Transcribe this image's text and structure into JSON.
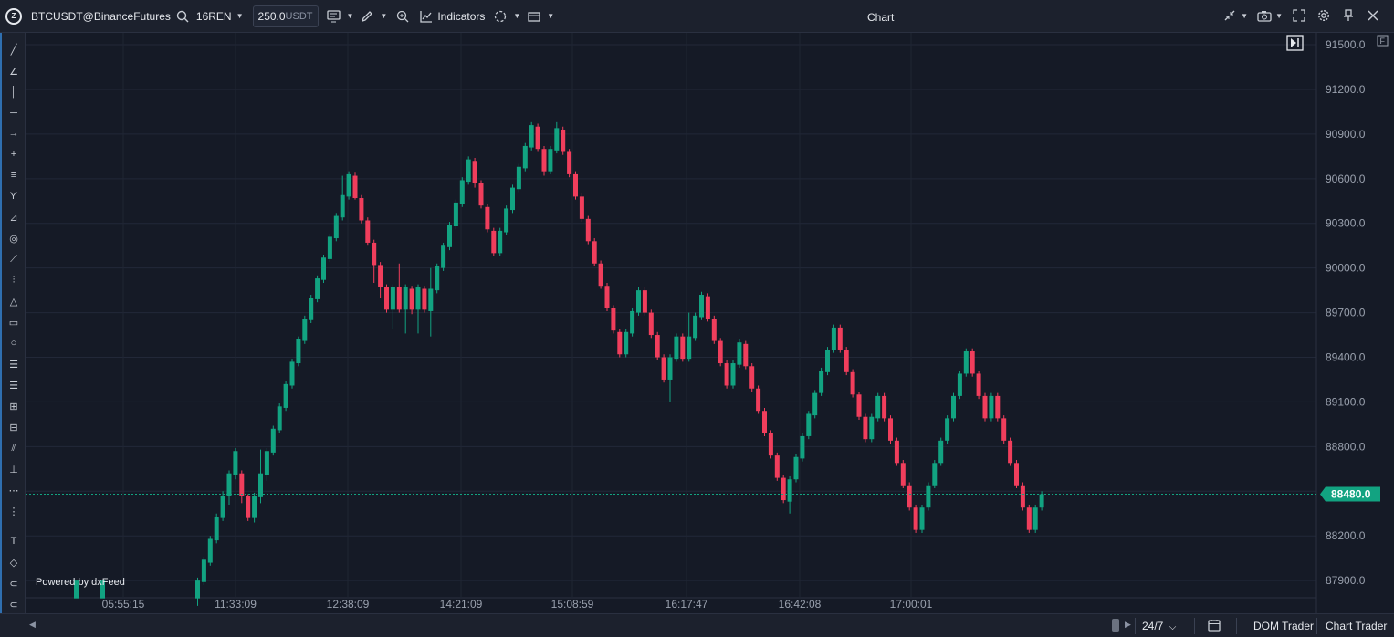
{
  "toolbar": {
    "symbol": "BTCUSDT@BinanceFutures",
    "timeframe": "16REN",
    "box_size": "250.0",
    "box_unit": "USDT",
    "indicators_label": "Indicators",
    "title": "Chart"
  },
  "left_tools": [
    "line-tool-icon",
    "angle-tool-icon",
    "vertical-line-icon",
    "horizontal-line-icon",
    "arrow-icon",
    "crosshair-icon",
    "parallel-lines-icon",
    "curve-icon",
    "trend-angle-icon",
    "spiral-icon",
    "ruler-icon",
    "pitchfork-icon",
    "triangle-icon",
    "rectangle-icon",
    "circle-icon",
    "fib-retracement-icon",
    "fib-extension-icon",
    "fib-fan-icon",
    "fib-levels-icon",
    "fib-channel-icon",
    "volume-profile-icon",
    "dotted-grid-icon",
    "dotted-column-icon",
    "text-tool-icon",
    "tag-icon",
    "label-icon",
    "callout-icon"
  ],
  "chart_data": {
    "type": "candlestick",
    "title": "",
    "xlabel": "",
    "ylabel": "",
    "ylim": [
      87680,
      91580
    ],
    "y_ticks": [
      "91500.0",
      "91200.0",
      "90900.0",
      "90600.0",
      "90300.0",
      "90000.0",
      "89700.0",
      "89400.0",
      "89100.0",
      "88800.0",
      "88500.0",
      "88200.0",
      "87900.0"
    ],
    "x_ticks": [
      "05:55:15",
      "11:33:09",
      "12:38:09",
      "14:21:09",
      "15:08:59",
      "16:17:47",
      "16:42:08",
      "17:00:01"
    ],
    "last_price": "88480.0",
    "grid": true,
    "up_color": "#12a381",
    "down_color": "#f03e5c",
    "candles": [
      [
        87780,
        87900,
        87730,
        87920
      ],
      [
        87890,
        88040,
        87870,
        88060
      ],
      [
        88020,
        88180,
        88000,
        88200
      ],
      [
        88170,
        88330,
        88150,
        88350
      ],
      [
        88320,
        88470,
        88300,
        88500
      ],
      [
        88470,
        88620,
        88410,
        88640
      ],
      [
        88610,
        88770,
        88580,
        88790
      ],
      [
        88620,
        88470,
        88420,
        88640
      ],
      [
        88470,
        88320,
        88300,
        88480
      ],
      [
        88320,
        88470,
        88290,
        88490
      ],
      [
        88460,
        88620,
        88420,
        88780
      ],
      [
        88610,
        88770,
        88570,
        88790
      ],
      [
        88760,
        88920,
        88740,
        88940
      ],
      [
        88910,
        89070,
        88890,
        89090
      ],
      [
        89060,
        89220,
        89040,
        89240
      ],
      [
        89210,
        89370,
        89190,
        89390
      ],
      [
        89360,
        89520,
        89340,
        89540
      ],
      [
        89510,
        89660,
        89490,
        89680
      ],
      [
        89650,
        89800,
        89630,
        89820
      ],
      [
        89790,
        89930,
        89770,
        89950
      ],
      [
        89920,
        90070,
        89900,
        90090
      ],
      [
        90060,
        90210,
        90040,
        90230
      ],
      [
        90200,
        90350,
        90180,
        90370
      ],
      [
        90340,
        90490,
        90320,
        90620
      ],
      [
        90480,
        90630,
        90460,
        90650
      ],
      [
        90620,
        90470,
        90460,
        90640
      ],
      [
        90470,
        90320,
        90300,
        90490
      ],
      [
        90320,
        90170,
        90150,
        90340
      ],
      [
        90170,
        90020,
        89900,
        90190
      ],
      [
        90020,
        89870,
        89800,
        90040
      ],
      [
        89870,
        89720,
        89700,
        89890
      ],
      [
        89720,
        89870,
        89590,
        89890
      ],
      [
        89870,
        89720,
        89700,
        90030
      ],
      [
        89720,
        89870,
        89560,
        89890
      ],
      [
        89860,
        89720,
        89690,
        89880
      ],
      [
        89720,
        89870,
        89560,
        89890
      ],
      [
        89860,
        89720,
        89700,
        89880
      ],
      [
        89710,
        89860,
        89540,
        90000
      ],
      [
        89850,
        90010,
        89830,
        90030
      ],
      [
        90000,
        90150,
        89980,
        90170
      ],
      [
        90140,
        90290,
        90120,
        90310
      ],
      [
        90280,
        90440,
        90260,
        90460
      ],
      [
        90430,
        90590,
        90410,
        90610
      ],
      [
        90580,
        90730,
        90560,
        90750
      ],
      [
        90720,
        90570,
        90540,
        90740
      ],
      [
        90570,
        90420,
        90400,
        90590
      ],
      [
        90410,
        90260,
        90240,
        90430
      ],
      [
        90250,
        90100,
        90080,
        90270
      ],
      [
        90100,
        90250,
        90080,
        90270
      ],
      [
        90240,
        90400,
        90220,
        90420
      ],
      [
        90390,
        90540,
        90370,
        90560
      ],
      [
        90530,
        90680,
        90510,
        90700
      ],
      [
        90670,
        90820,
        90650,
        90840
      ],
      [
        90810,
        90960,
        90790,
        90980
      ],
      [
        90950,
        90800,
        90780,
        90970
      ],
      [
        90800,
        90650,
        90620,
        90820
      ],
      [
        90650,
        90800,
        90630,
        90820
      ],
      [
        90790,
        90940,
        90770,
        90980
      ],
      [
        90930,
        90780,
        90760,
        90950
      ],
      [
        90780,
        90630,
        90610,
        90800
      ],
      [
        90630,
        90480,
        90460,
        90650
      ],
      [
        90480,
        90330,
        90310,
        90500
      ],
      [
        90330,
        90180,
        90160,
        90350
      ],
      [
        90180,
        90030,
        90010,
        90200
      ],
      [
        90030,
        89880,
        89860,
        90050
      ],
      [
        89880,
        89730,
        89710,
        89900
      ],
      [
        89730,
        89580,
        89560,
        89750
      ],
      [
        89570,
        89420,
        89400,
        89590
      ],
      [
        89420,
        89570,
        89400,
        89590
      ],
      [
        89560,
        89710,
        89540,
        89730
      ],
      [
        89700,
        89850,
        89680,
        89870
      ],
      [
        89850,
        89700,
        89680,
        89870
      ],
      [
        89700,
        89550,
        89530,
        89720
      ],
      [
        89550,
        89400,
        89380,
        89570
      ],
      [
        89400,
        89250,
        89230,
        89420
      ],
      [
        89250,
        89400,
        89100,
        89420
      ],
      [
        89390,
        89540,
        89370,
        89560
      ],
      [
        89540,
        89390,
        89370,
        89560
      ],
      [
        89390,
        89540,
        89370,
        89700
      ],
      [
        89530,
        89680,
        89510,
        89700
      ],
      [
        89670,
        89820,
        89650,
        89840
      ],
      [
        89810,
        89660,
        89640,
        89830
      ],
      [
        89660,
        89510,
        89490,
        89680
      ],
      [
        89510,
        89360,
        89340,
        89530
      ],
      [
        89360,
        89210,
        89190,
        89380
      ],
      [
        89210,
        89360,
        89190,
        89380
      ],
      [
        89350,
        89500,
        89330,
        89520
      ],
      [
        89490,
        89340,
        89320,
        89510
      ],
      [
        89340,
        89190,
        89170,
        89360
      ],
      [
        89190,
        89040,
        89020,
        89210
      ],
      [
        89040,
        88890,
        88870,
        89060
      ],
      [
        88890,
        88740,
        88720,
        88910
      ],
      [
        88740,
        88590,
        88570,
        88760
      ],
      [
        88590,
        88440,
        88420,
        88610
      ],
      [
        88430,
        88580,
        88350,
        88600
      ],
      [
        88580,
        88730,
        88560,
        88750
      ],
      [
        88720,
        88870,
        88700,
        88890
      ],
      [
        88870,
        89020,
        88850,
        89040
      ],
      [
        89010,
        89160,
        88990,
        89180
      ],
      [
        89160,
        89310,
        89140,
        89330
      ],
      [
        89300,
        89450,
        89280,
        89470
      ],
      [
        89450,
        89600,
        89430,
        89620
      ],
      [
        89600,
        89450,
        89430,
        89620
      ],
      [
        89450,
        89300,
        89280,
        89470
      ],
      [
        89300,
        89150,
        89130,
        89320
      ],
      [
        89150,
        89000,
        88980,
        89170
      ],
      [
        89000,
        88850,
        88830,
        89020
      ],
      [
        88850,
        89000,
        88830,
        89020
      ],
      [
        88990,
        89140,
        88970,
        89160
      ],
      [
        89140,
        88990,
        88970,
        89160
      ],
      [
        88990,
        88840,
        88820,
        89010
      ],
      [
        88840,
        88690,
        88670,
        88860
      ],
      [
        88690,
        88540,
        88520,
        88710
      ],
      [
        88540,
        88390,
        88370,
        88560
      ],
      [
        88390,
        88240,
        88220,
        88410
      ],
      [
        88240,
        88390,
        88220,
        88410
      ],
      [
        88390,
        88540,
        88370,
        88560
      ],
      [
        88540,
        88690,
        88520,
        88710
      ],
      [
        88690,
        88840,
        88670,
        88860
      ],
      [
        88840,
        88990,
        88820,
        89010
      ],
      [
        88990,
        89140,
        88970,
        89160
      ],
      [
        89140,
        89290,
        89120,
        89310
      ],
      [
        89290,
        89440,
        89270,
        89460
      ],
      [
        89440,
        89290,
        89270,
        89460
      ],
      [
        89290,
        89140,
        89120,
        89310
      ],
      [
        89140,
        88990,
        88970,
        89160
      ],
      [
        88990,
        89140,
        88970,
        89160
      ],
      [
        89140,
        88990,
        88970,
        89160
      ],
      [
        88990,
        88840,
        88820,
        89010
      ],
      [
        88840,
        88690,
        88670,
        88860
      ],
      [
        88690,
        88540,
        88520,
        88710
      ],
      [
        88540,
        88390,
        88370,
        88560
      ],
      [
        88390,
        88240,
        88220,
        88410
      ],
      [
        88240,
        88390,
        88220,
        88410
      ],
      [
        88390,
        88480,
        88370,
        88500
      ]
    ]
  },
  "bottom": {
    "session": "24/7",
    "dom_trader": "DOM Trader",
    "chart_trader": "Chart Trader"
  },
  "watermark": "Powered by dxFeed"
}
